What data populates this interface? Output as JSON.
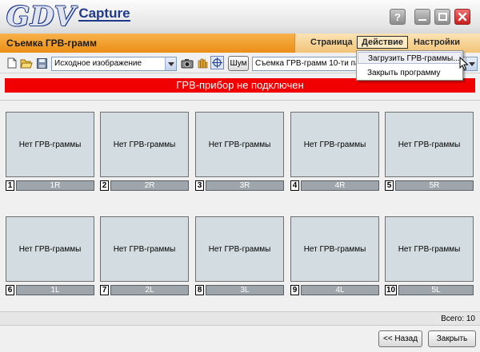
{
  "app": {
    "logo_main": "GDV",
    "logo_sub": "Capture",
    "help_glyph": "?"
  },
  "header": {
    "title": "Съемка ГРВ-грамм",
    "tabs": [
      "Страница",
      "Действие",
      "Настройки"
    ]
  },
  "menu": {
    "items": [
      "Загрузить ГРВ-граммы...",
      "Закрыть программу"
    ]
  },
  "toolbar": {
    "image_select": "Исходное изображение",
    "noise_label": "Шум",
    "mode_select": "Съемка ГРВ-грамм 10-ти пальцев"
  },
  "status": {
    "banner": "ГРВ-прибор не подключен"
  },
  "grid": {
    "empty_text": "Нет ГРВ-граммы",
    "cells": [
      {
        "num": "1",
        "label": "1R"
      },
      {
        "num": "2",
        "label": "2R"
      },
      {
        "num": "3",
        "label": "3R"
      },
      {
        "num": "4",
        "label": "4R"
      },
      {
        "num": "5",
        "label": "5R"
      },
      {
        "num": "6",
        "label": "1L"
      },
      {
        "num": "7",
        "label": "2L"
      },
      {
        "num": "8",
        "label": "3L"
      },
      {
        "num": "9",
        "label": "4L"
      },
      {
        "num": "10",
        "label": "5L"
      }
    ]
  },
  "footer": {
    "total": "Всего: 10",
    "back_label": "<< Назад",
    "close_label": "Закрыть"
  },
  "colors": {
    "accent_orange": "#eb8e16",
    "banner_red": "#f00000",
    "cell_bg": "#d3dde1",
    "label_gray": "#9ea6ac",
    "logo_blue": "#1f3a8a"
  },
  "icons": [
    "new-file-icon",
    "open-folder-icon",
    "save-icon",
    "camera-icon",
    "fingers-icon",
    "crosshair-icon",
    "close-icon",
    "minimize-icon",
    "maximize-icon",
    "help-icon",
    "cursor-icon"
  ]
}
